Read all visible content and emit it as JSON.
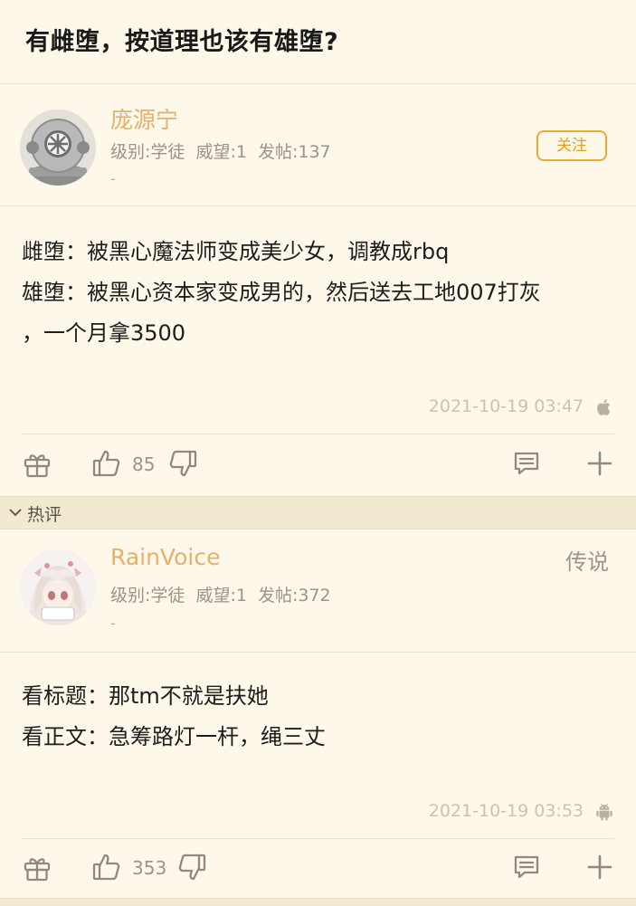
{
  "thread": {
    "title": "有雌堕，按道理也该有雄堕?"
  },
  "hot_section": {
    "label": "热评"
  },
  "posts": [
    {
      "author": "庞源宁",
      "meta": "级别:学徒  威望:1  发帖:137",
      "signature": "-",
      "follow_label": "关注",
      "content": [
        "雌堕：被黑心魔法师变成美少女，调教成rbq",
        "雄堕：被黑心资本家变成男的，然后送去工地007打灰",
        "，一个月拿3500"
      ],
      "timestamp": "2021-10-19 03:47",
      "device_icon": "apple-icon",
      "likes": "85"
    },
    {
      "author": "RainVoice",
      "rank_label": "传说",
      "meta": "级别:学徒  威望:1  发帖:372",
      "signature": "-",
      "content": [
        "看标题：那tm不就是扶她",
        "看正文：急筹路灯一杆，绳三丈"
      ],
      "timestamp": "2021-10-19 03:53",
      "device_icon": "android-icon",
      "likes": "353"
    }
  ],
  "colors": {
    "background": "#fdf8e9",
    "author_name": "#e6b06e",
    "follow_accent": "#f0a92a",
    "hot_header_bg": "#f1ead1"
  }
}
